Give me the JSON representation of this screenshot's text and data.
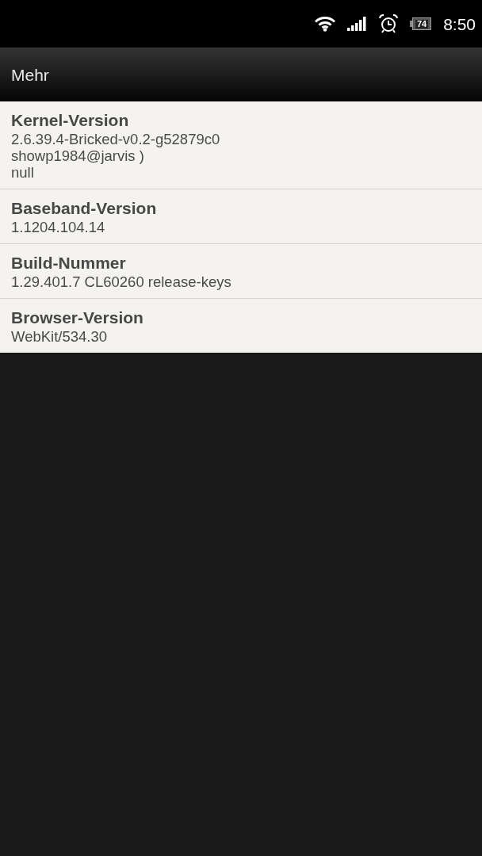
{
  "status_bar": {
    "battery": "74",
    "time": "8:50"
  },
  "title_bar": {
    "title": "Mehr"
  },
  "items": [
    {
      "title": "Kernel-Version",
      "value": "2.6.39.4-Bricked-v0.2-g52879c0\nshowp1984@jarvis )\nnull"
    },
    {
      "title": "Baseband-Version",
      "value": "1.1204.104.14"
    },
    {
      "title": "Build-Nummer",
      "value": "1.29.401.7 CL60260 release-keys"
    },
    {
      "title": "Browser-Version",
      "value": "WebKit/534.30"
    }
  ]
}
